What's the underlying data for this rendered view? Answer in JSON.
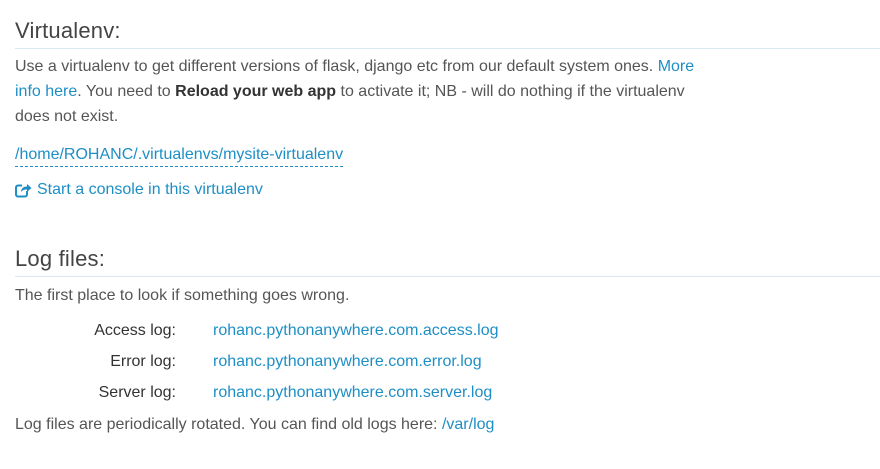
{
  "virtualenv": {
    "title": "Virtualenv:",
    "desc_part1": "Use a virtualenv to get different versions of flask, django etc from our default system ones. ",
    "more_info_link": "More info here",
    "desc_part2": ". You need to ",
    "reload_bold": "Reload your web app",
    "desc_part3": " to activate it; NB - will do nothing if the virtualenv does not exist.",
    "path": "/home/ROHANC/.virtualenvs/mysite-virtualenv",
    "console_link": "Start a console in this virtualenv",
    "console_icon": "external-link-icon"
  },
  "logs": {
    "title": "Log files:",
    "intro": "The first place to look if something goes wrong.",
    "rows": [
      {
        "label": "Access log:",
        "file": "rohanc.pythonanywhere.com.access.log"
      },
      {
        "label": "Error log:",
        "file": "rohanc.pythonanywhere.com.error.log"
      },
      {
        "label": "Server log:",
        "file": "rohanc.pythonanywhere.com.server.log"
      }
    ],
    "footer_text": "Log files are periodically rotated. You can find old logs here: ",
    "footer_link": "/var/log"
  },
  "colors": {
    "link": "#1e8fc6",
    "text": "#555555",
    "rule": "#d7e9f2"
  }
}
